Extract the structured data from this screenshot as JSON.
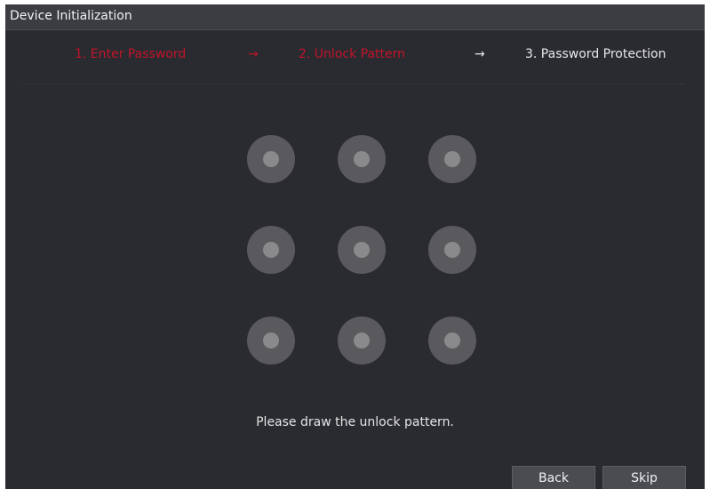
{
  "window": {
    "title": "Device Initialization"
  },
  "steps": {
    "step1": "1.  Enter Password",
    "arrow1": "→",
    "step2": "2.  Unlock Pattern",
    "arrow2": "→",
    "step3": "3.  Password Protection",
    "completed_or_current": [
      "step1",
      "step2"
    ]
  },
  "pattern": {
    "grid": "3x3",
    "dot_count": 9
  },
  "hint": "Please draw the unlock pattern.",
  "buttons": {
    "back": "Back",
    "skip": "Skip"
  },
  "colors": {
    "background": "#2a2b30",
    "titlebar": "#3c3d43",
    "active_step": "#c0142a",
    "inactive_step": "#e8e8e8",
    "dot_outer": "#5a5a5e",
    "dot_inner": "#8a8a8d"
  }
}
